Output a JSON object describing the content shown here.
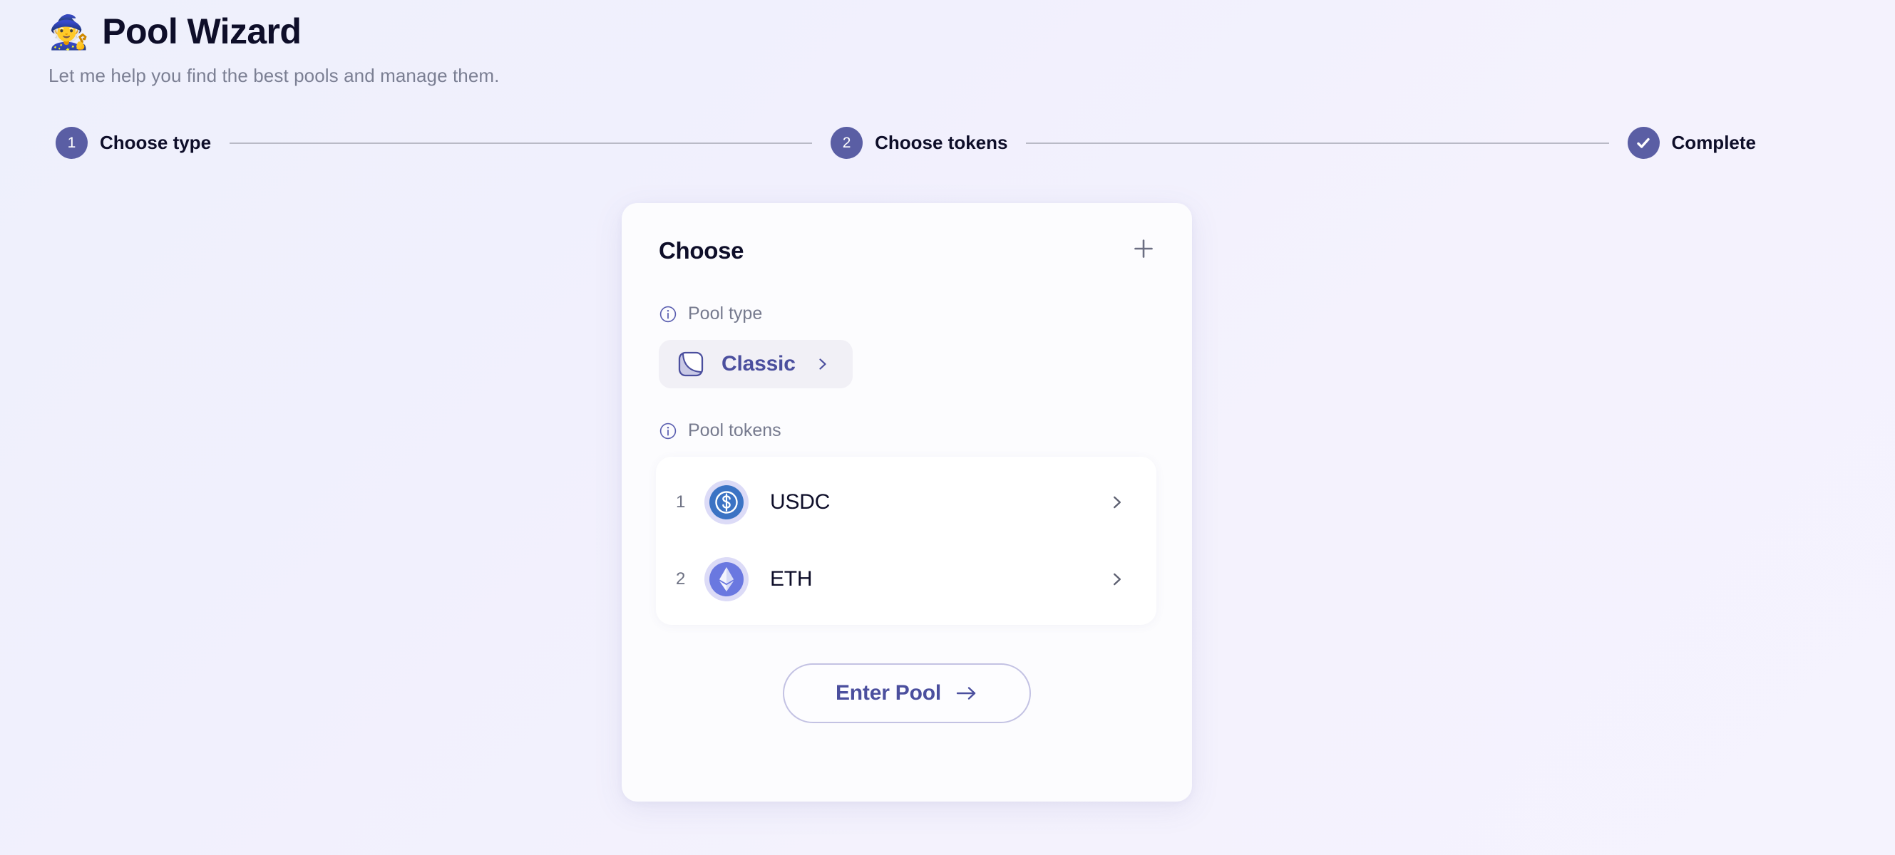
{
  "header": {
    "emoji": "🧙",
    "title": "Pool Wizard",
    "subtitle": "Let me help you find the best pools and manage them."
  },
  "stepper": {
    "steps": [
      {
        "badge": "1",
        "label": "Choose type",
        "state": "active"
      },
      {
        "badge": "2",
        "label": "Choose tokens",
        "state": "active"
      },
      {
        "badge": "✔",
        "label": "Complete",
        "state": "complete"
      }
    ]
  },
  "card": {
    "title": "Choose",
    "add_icon": "plus-icon",
    "pool_type": {
      "label": "Pool type",
      "info_icon": "info-icon",
      "selected": "Classic",
      "chip_icon": "classic-pool-icon",
      "chevron_icon": "chevron-right-icon"
    },
    "pool_tokens": {
      "label": "Pool tokens",
      "info_icon": "info-icon",
      "tokens": [
        {
          "index": "1",
          "symbol": "USDC",
          "icon": "usdc-token-icon",
          "chevron_icon": "chevron-right-icon"
        },
        {
          "index": "2",
          "symbol": "ETH",
          "icon": "eth-token-icon",
          "chevron_icon": "chevron-right-icon"
        }
      ]
    },
    "cta": {
      "label": "Enter Pool",
      "icon": "arrow-right-icon"
    }
  },
  "colors": {
    "background_start": "#eef0fc",
    "background_end": "#f5f3fe",
    "accent_indigo": "#4b4f9e",
    "step_badge": "#5a5ea4",
    "card_surface": "#fcfcfe",
    "title_text": "#0e0e29",
    "muted_text": "#767a8e",
    "usdc_blue": "#3b73c4",
    "eth_indigo": "#6a78e0",
    "token_ring": "#dcdbf7"
  }
}
